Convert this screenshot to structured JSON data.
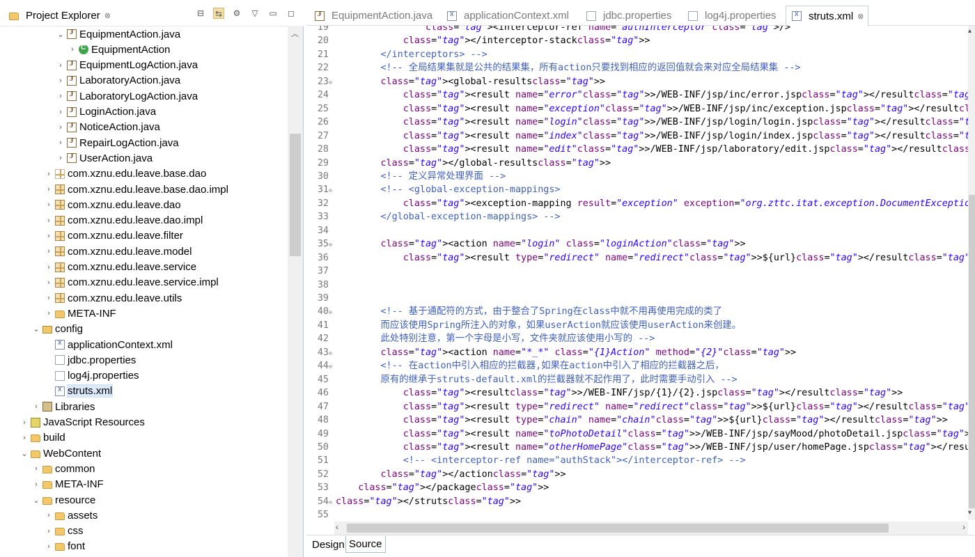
{
  "explorer": {
    "title": "Project Explorer",
    "close_glyph": "⊗",
    "items": [
      {
        "label": "EquipmentAction.java",
        "icon": "java-file-icon",
        "arrow": "⌵",
        "expanded": true
      },
      {
        "label": "EquipmentAction",
        "icon": "class-icon",
        "arrow": "›"
      },
      {
        "label": "EquipmentLogAction.java",
        "icon": "java-file-icon",
        "arrow": "›"
      },
      {
        "label": "LaboratoryAction.java",
        "icon": "java-file-icon",
        "arrow": "›"
      },
      {
        "label": "LaboratoryLogAction.java",
        "icon": "java-file-icon",
        "arrow": "›"
      },
      {
        "label": "LoginAction.java",
        "icon": "java-file-icon",
        "arrow": "›"
      },
      {
        "label": "NoticeAction.java",
        "icon": "java-file-icon",
        "arrow": "›"
      },
      {
        "label": "RepairLogAction.java",
        "icon": "java-file-icon",
        "arrow": "›"
      },
      {
        "label": "UserAction.java",
        "icon": "java-file-icon",
        "arrow": "›"
      },
      {
        "label": "com.xznu.edu.leave.base.dao",
        "icon": "empty-package-icon",
        "arrow": "›"
      },
      {
        "label": "com.xznu.edu.leave.base.dao.impl",
        "icon": "package-icon",
        "arrow": "›"
      },
      {
        "label": "com.xznu.edu.leave.dao",
        "icon": "package-icon",
        "arrow": "›"
      },
      {
        "label": "com.xznu.edu.leave.dao.impl",
        "icon": "package-icon",
        "arrow": "›"
      },
      {
        "label": "com.xznu.edu.leave.filter",
        "icon": "package-icon",
        "arrow": "›"
      },
      {
        "label": "com.xznu.edu.leave.model",
        "icon": "package-icon",
        "arrow": "›"
      },
      {
        "label": "com.xznu.edu.leave.service",
        "icon": "package-icon",
        "arrow": "›"
      },
      {
        "label": "com.xznu.edu.leave.service.impl",
        "icon": "package-icon",
        "arrow": "›"
      },
      {
        "label": "com.xznu.edu.leave.utils",
        "icon": "package-icon",
        "arrow": "›"
      },
      {
        "label": "META-INF",
        "icon": "folder-icon",
        "arrow": "›"
      },
      {
        "label": "config",
        "icon": "source-folder-icon",
        "arrow": "⌵",
        "expanded": true
      },
      {
        "label": "applicationContext.xml",
        "icon": "xml-file-icon",
        "arrow": ""
      },
      {
        "label": "jdbc.properties",
        "icon": "properties-file-icon",
        "arrow": ""
      },
      {
        "label": "log4j.properties",
        "icon": "properties-file-icon",
        "arrow": ""
      },
      {
        "label": "struts.xml",
        "icon": "xml-file-icon",
        "arrow": "",
        "selected": true
      },
      {
        "label": "Libraries",
        "icon": "library-icon",
        "arrow": "›"
      },
      {
        "label": "JavaScript Resources",
        "icon": "javascript-icon",
        "arrow": "›"
      },
      {
        "label": "build",
        "icon": "folder-icon",
        "arrow": "›"
      },
      {
        "label": "WebContent",
        "icon": "folder-icon",
        "arrow": "⌵",
        "expanded": true
      },
      {
        "label": "common",
        "icon": "folder-icon",
        "arrow": "›"
      },
      {
        "label": "META-INF",
        "icon": "folder-icon",
        "arrow": "›"
      },
      {
        "label": "resource",
        "icon": "folder-icon",
        "arrow": "⌵",
        "expanded": true
      },
      {
        "label": "assets",
        "icon": "folder-icon",
        "arrow": "›"
      },
      {
        "label": "css",
        "icon": "folder-icon",
        "arrow": "›"
      },
      {
        "label": "font",
        "icon": "folder-icon",
        "arrow": "›"
      }
    ]
  },
  "editor": {
    "tabs": [
      {
        "label": "EquipmentAction.java",
        "icon": "java-file-icon",
        "active": false
      },
      {
        "label": "applicationContext.xml",
        "icon": "xml-file-icon",
        "active": false
      },
      {
        "label": "jdbc.properties",
        "icon": "properties-file-icon",
        "active": false
      },
      {
        "label": "log4j.properties",
        "icon": "properties-file-icon",
        "active": false
      },
      {
        "label": "struts.xml",
        "icon": "xml-file-icon",
        "active": true,
        "close": "⊗"
      }
    ],
    "lines": [
      {
        "n": "19",
        "fold": "",
        "text": "                <interceptor-ref name=\"authInterceptor\"/>"
      },
      {
        "n": "20",
        "fold": "",
        "text": "            </interceptor-stack>"
      },
      {
        "n": "21",
        "fold": "",
        "text": "        </interceptors> -->"
      },
      {
        "n": "22",
        "fold": "",
        "text": "        <!-- 全局结果集就是公共的结果集，所有action只要找到相应的返回值就会来对应全局结果集 -->"
      },
      {
        "n": "23",
        "fold": "⊖",
        "text": "        <global-results>"
      },
      {
        "n": "24",
        "fold": "",
        "text": "            <result name=\"error\">/WEB-INF/jsp/inc/error.jsp</result>"
      },
      {
        "n": "25",
        "fold": "",
        "text": "            <result name=\"exception\">/WEB-INF/jsp/inc/exception.jsp</result>"
      },
      {
        "n": "26",
        "fold": "",
        "text": "            <result name=\"login\">/WEB-INF/jsp/login/login.jsp</result>"
      },
      {
        "n": "27",
        "fold": "",
        "text": "            <result name=\"index\">/WEB-INF/jsp/login/index.jsp</result>"
      },
      {
        "n": "28",
        "fold": "",
        "text": "            <result name=\"edit\">/WEB-INF/jsp/laboratory/edit.jsp</result>"
      },
      {
        "n": "29",
        "fold": "",
        "text": "        </global-results>"
      },
      {
        "n": "30",
        "fold": "",
        "text": "        <!-- 定义异常处理界面 -->"
      },
      {
        "n": "31",
        "fold": "⊖",
        "text": "        <!-- <global-exception-mappings>"
      },
      {
        "n": "32",
        "fold": "",
        "text": "            <exception-mapping result=\"exception\" exception=\"org.zttc.itat.exception.DocumentException\"></excep"
      },
      {
        "n": "33",
        "fold": "",
        "text": "        </global-exception-mappings> -->"
      },
      {
        "n": "34",
        "fold": "",
        "text": ""
      },
      {
        "n": "35",
        "fold": "⊖",
        "text": "        <action name=\"login\" class=\"loginAction\">"
      },
      {
        "n": "36",
        "fold": "",
        "text": "            <result type=\"redirect\" name=\"redirect\">${url}</result>"
      },
      {
        "n": "37",
        "fold": "",
        "text": ""
      },
      {
        "n": "38",
        "fold": "",
        "text": ""
      },
      {
        "n": "39",
        "fold": "",
        "text": ""
      },
      {
        "n": "40",
        "fold": "⊖",
        "text": "        <!-- 基于通配符的方式，由于整合了Spring在class中就不用再使用完成的类了"
      },
      {
        "n": "41",
        "fold": "",
        "text": "        而应该使用Spring所注入的对象，如果userAction就应该使用userAction来创建。"
      },
      {
        "n": "42",
        "fold": "",
        "text": "        此处特别注意，第一个字母是小写，文件夹就应该使用小写的 -->"
      },
      {
        "n": "43",
        "fold": "⊖",
        "text": "        <action name=\"*_*\" class=\"{1}Action\" method=\"{2}\">"
      },
      {
        "n": "44",
        "fold": "⊖",
        "text": "        <!-- 在action中引入相应的拦截器,如果在action中引入了相应的拦截器之后，"
      },
      {
        "n": "45",
        "fold": "",
        "text": "        原有的继承于struts-default.xml的拦截器就不起作用了，此时需要手动引入 -->"
      },
      {
        "n": "46",
        "fold": "",
        "text": "            <result>/WEB-INF/jsp/{1}/{2}.jsp</result>"
      },
      {
        "n": "47",
        "fold": "",
        "text": "            <result type=\"redirect\" name=\"redirect\">${url}</result>"
      },
      {
        "n": "48",
        "fold": "",
        "text": "            <result type=\"chain\" name=\"chain\">${url}</result>"
      },
      {
        "n": "49",
        "fold": "",
        "text": "            <result name=\"toPhotoDetail\">/WEB-INF/jsp/sayMood/photoDetail.jsp</result>"
      },
      {
        "n": "50",
        "fold": "",
        "text": "            <result name=\"otherHomePage\">/WEB-INF/jsp/user/homePage.jsp</result>"
      },
      {
        "n": "51",
        "fold": "",
        "text": "            <!-- <interceptor-ref name=\"authStack\"></interceptor-ref> -->"
      },
      {
        "n": "52",
        "fold": "",
        "text": "        </action>"
      },
      {
        "n": "53",
        "fold": "",
        "text": "    </package>"
      },
      {
        "n": "54",
        "fold": "⊖",
        "text": "</struts>"
      },
      {
        "n": "55",
        "fold": "",
        "text": ""
      }
    ],
    "bottom_tabs": [
      {
        "label": "Design",
        "active": false
      },
      {
        "label": "Source",
        "active": true
      }
    ]
  },
  "colors": {
    "comment": "#3f5fbf",
    "tag": "#3f7f7f",
    "attribute": "#7f007f",
    "value": "#2a00ff",
    "selection": "#dbe9fb"
  }
}
